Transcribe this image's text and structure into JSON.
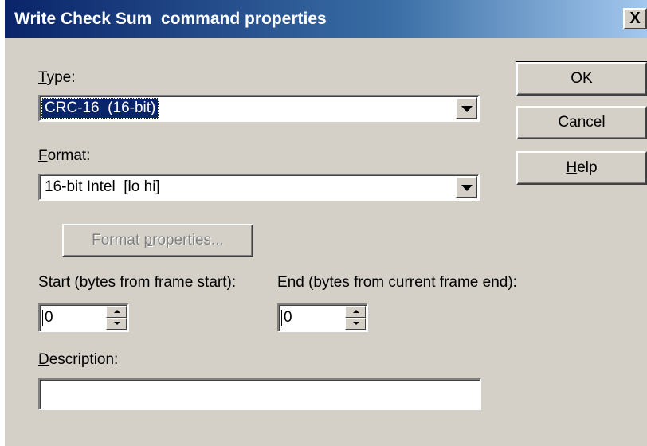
{
  "dialog": {
    "title": "Write Check Sum  command properties",
    "close_label": "X"
  },
  "type": {
    "label_hotkey": "T",
    "label_rest": "ype:",
    "value": "CRC-16  (16-bit)"
  },
  "format": {
    "label_hotkey": "F",
    "label_rest": "ormat:",
    "value": "16-bit Intel  [lo hi]"
  },
  "format_properties": {
    "label_before": "Format ",
    "label_hotkey": "p",
    "label_after": "roperties..."
  },
  "start": {
    "label_hotkey": "S",
    "label_rest": "tart (bytes from frame start):",
    "value": "0"
  },
  "end": {
    "label_hotkey": "E",
    "label_rest": "nd (bytes from current frame end):",
    "value": "0"
  },
  "description": {
    "label_hotkey": "D",
    "label_rest": "escription:",
    "value": ""
  },
  "buttons": {
    "ok": "OK",
    "cancel": "Cancel",
    "help_hotkey": "H",
    "help_rest": "elp"
  },
  "colors": {
    "title_bar_start": "#0a246a",
    "title_bar_end": "#a6caf0",
    "face": "#d4d0c8",
    "selection": "#0a246a"
  }
}
